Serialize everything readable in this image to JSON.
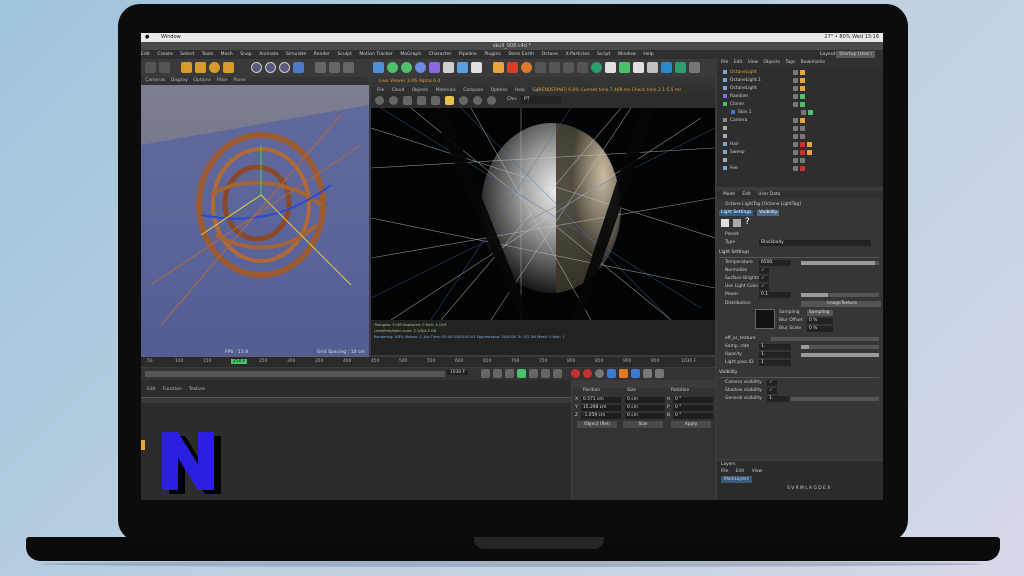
{
  "macbar": {
    "app": "",
    "menu": "Window",
    "status": "27°  • 80%  Wed 13:16"
  },
  "window": {
    "title": "skull_008.c4d *"
  },
  "menus": [
    "Edit",
    "Create",
    "Select",
    "Tools",
    "Mesh",
    "Snap",
    "Animate",
    "Simulate",
    "Render",
    "Sculpt",
    "Motion Tracker",
    "MoGraph",
    "Character",
    "Pipeline",
    "Plugins",
    "Stem Earth",
    "Octane",
    "X-Particles",
    "Script",
    "Window",
    "Help"
  ],
  "menubar_layout_label": "Layout:",
  "menubar_layout_value": "Startup (User)",
  "left_viewport": {
    "menu": [
      "Cameras",
      "Display",
      "Options",
      "Filter",
      "Panel"
    ],
    "fps": "FPS : 13.8",
    "grid": "Grid Spacing : 10 cm"
  },
  "render_viewport": {
    "title": "Live Viewer 3.06 Alpha 6.0",
    "menu": [
      "File",
      "Cloud",
      "Objects",
      "Materials",
      "Compare",
      "Options",
      "Help",
      "Gui"
    ],
    "stats_line": "[RENDERING] 6.8% Current time 7.469 ms  Check time 2.1-5.5 ms",
    "channel_label": "Chn:",
    "channel_value": "PT",
    "status_lines": [
      "Triangles: 5.1M   Displaced: 0   Hair: 4.12M",
      "Used/free/total vram: 2.1/6/4.3 GB",
      "Rendering: 6.8%   Ms/sec: 1.1kb   Time: 00:00:03/00:00:05   Spp/maxspp: 34/5000   Tri: 0/2.5M  Mesh: 0  Hair: 1"
    ]
  },
  "timeline": {
    "ticks": [
      "50",
      "100",
      "150",
      "200",
      "250",
      "300",
      "350",
      "400",
      "450",
      "500",
      "550",
      "600",
      "650",
      "700",
      "750",
      "800",
      "850",
      "900",
      "950",
      "1000"
    ],
    "current_frame": "250 F",
    "end_frame": "1030 F",
    "start_frame": "1030 F",
    "tabs": [
      "Edit",
      "Function",
      "Texture"
    ]
  },
  "coordinates": {
    "headers": [
      "Position",
      "Size",
      "Rotation"
    ],
    "rows": [
      {
        "axis": "X",
        "pos": "0.571 cm",
        "size": "0 cm",
        "rot_axis": "H",
        "rot": "0 °"
      },
      {
        "axis": "Y",
        "pos": "15.298 cm",
        "size": "0 cm",
        "rot_axis": "P",
        "rot": "0 °"
      },
      {
        "axis": "Z",
        "pos": "-1.059 cm",
        "size": "0 cm",
        "rot_axis": "B",
        "rot": "0 °"
      }
    ],
    "mode": "Object (Rel)",
    "size_mode": "Size",
    "apply": "Apply"
  },
  "object_manager": {
    "menu": [
      "File",
      "Edit",
      "View",
      "Objects",
      "Tags",
      "Bookmarks"
    ],
    "objects": [
      {
        "name": "OctaneLight",
        "highlight": true
      },
      {
        "name": "OctaneLight.1",
        "highlight": false
      },
      {
        "name": "OctaneLight",
        "highlight": false
      },
      {
        "name": "Random",
        "highlight": false
      },
      {
        "name": "Cloner",
        "highlight": false
      },
      {
        "name": "Skin.1",
        "highlight": false
      },
      {
        "name": "Camera",
        "highlight": false
      },
      {
        "name": "",
        "highlight": false
      },
      {
        "name": "",
        "highlight": false
      },
      {
        "name": "Hair",
        "highlight": false
      },
      {
        "name": "Sweep",
        "highlight": false
      },
      {
        "name": "",
        "highlight": false
      },
      {
        "name": "Fee",
        "highlight": false
      }
    ]
  },
  "attributes": {
    "menu": [
      "Mode",
      "Edit",
      "User Data"
    ],
    "tag_title": "Octane LightTag [Octane LightTag]",
    "tabs": [
      "Light Settings",
      "Visibility"
    ],
    "preset_label": "Preset",
    "type_label": "Type",
    "type_value": "Blackbody",
    "section_light": "Light Settings",
    "rows": [
      {
        "label": "Temperature",
        "value": "6500.",
        "fill": 0.95
      },
      {
        "label": "Normalize",
        "value": "✓",
        "fill": 0
      },
      {
        "label": "Surface Brightness",
        "value": "✓",
        "fill": 0
      },
      {
        "label": "Use Light Color",
        "value": "✓",
        "fill": 0
      },
      {
        "label": "Power",
        "value": "0.1",
        "fill": 0.35
      }
    ],
    "distribution_label": "Distribution",
    "distribution_value": "ImageTexture",
    "sampling_label": "Sampling",
    "sampling_value": "Sampling",
    "blur_offset_label": "Blur Offset",
    "blur_offset_value": "0 %",
    "blur_scale_label": "Blur Scale",
    "blur_scale_value": "0 %",
    "rows2": [
      {
        "label": "eff_or_texture",
        "value": ""
      },
      {
        "label": "Samp. rate",
        "value": "1.",
        "fill": 0.1
      },
      {
        "label": "Opacity",
        "value": "1.",
        "fill": 1
      },
      {
        "label": "Light pass ID",
        "value": "1",
        "fill": 0
      }
    ],
    "section_visibility": "Visibility",
    "rows3": [
      {
        "label": "Camera visibility",
        "value": "✓"
      },
      {
        "label": "Shadow visibility",
        "value": "✓"
      },
      {
        "label": "General visibility",
        "value": "1."
      }
    ]
  },
  "layers": {
    "title": "Layers",
    "menu": [
      "File",
      "Edit",
      "View"
    ],
    "item": "MainLayers",
    "columns": "S V R M L A G D E X"
  },
  "colors": {
    "accent": "#e8a33c",
    "logo_blue": "#2a1fe0",
    "octane_selected": "#e8a33c"
  }
}
